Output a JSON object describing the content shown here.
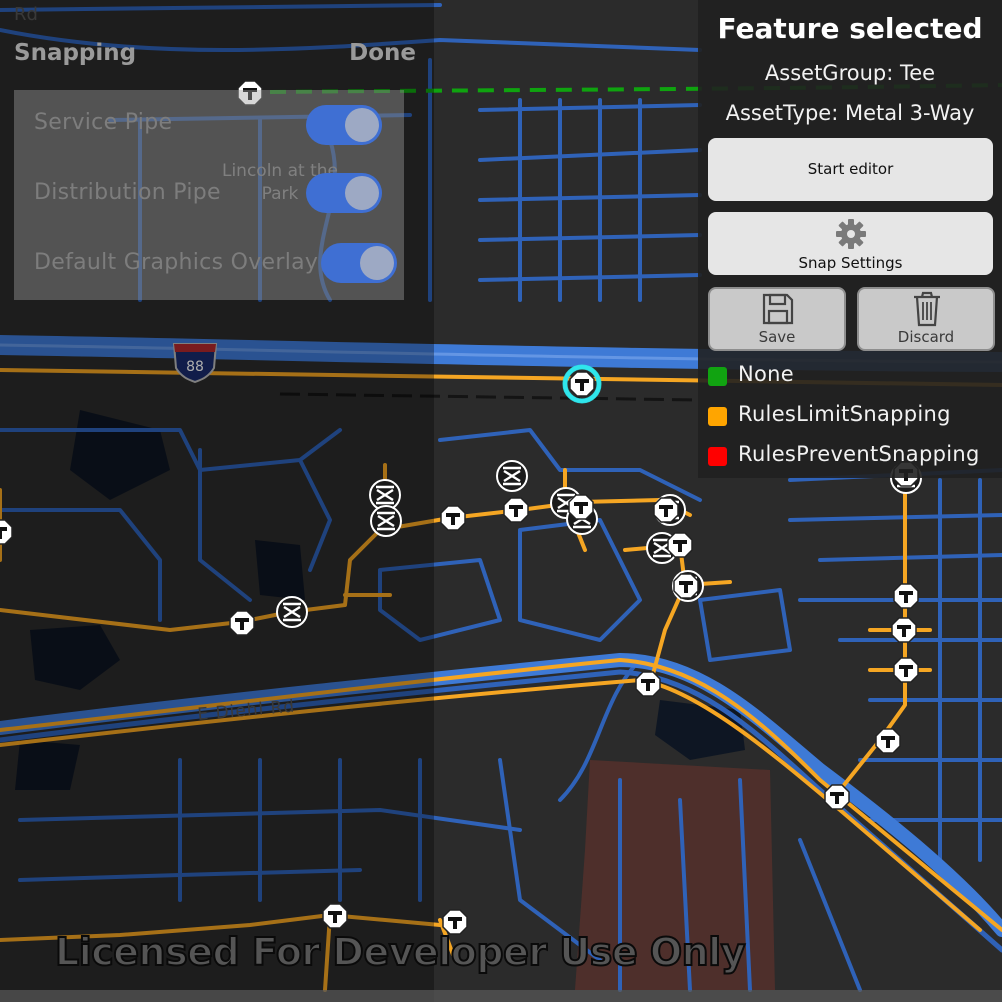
{
  "map": {
    "road_labels": {
      "interstate_shield": "88",
      "diehl": "E Diehl Rd",
      "rd_fragment": "Rd"
    },
    "place_labels": {
      "lincoln": "Lincoln at the\nPark"
    },
    "colors": {
      "street": "#2f62b8",
      "highway": "#3e7ad6",
      "pipe": "#f5a623",
      "boundary": "#0fa30f",
      "land": "#2b2b2b",
      "water": "#0e1623",
      "building": "#55302c"
    },
    "watermark": "Licensed For Developer Use Only"
  },
  "snapping": {
    "title": "Snapping",
    "done_label": "Done",
    "layers": [
      {
        "label": "Service Pipe",
        "enabled": true
      },
      {
        "label": "Distribution Pipe",
        "enabled": true
      },
      {
        "label": "Default Graphics Overlay",
        "enabled": true
      }
    ]
  },
  "feature_panel": {
    "title": "Feature selected",
    "asset_group": "AssetGroup: Tee",
    "asset_type": "AssetType: Metal 3-Way",
    "start_editor_label": "Start editor",
    "snap_settings_label": "Snap Settings",
    "snap_settings_icon": "gear-icon",
    "save_label": "Save",
    "save_icon": "floppy-disk-icon",
    "discard_label": "Discard",
    "discard_icon": "trash-icon"
  },
  "legend": [
    {
      "label": "None",
      "color": "#11a311"
    },
    {
      "label": "RulesLimitSnapping",
      "color": "#ffa500"
    },
    {
      "label": "RulesPreventSnapping",
      "color": "#ff0000"
    }
  ]
}
